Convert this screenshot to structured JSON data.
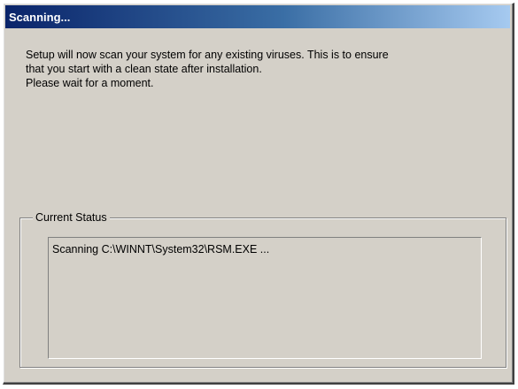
{
  "window": {
    "title": "Scanning..."
  },
  "message": {
    "line1": "Setup will now scan your system for any existing viruses. This is to ensure",
    "line2": "that you start with a clean state after installation.",
    "line3": "Please wait for a moment."
  },
  "status_group": {
    "label": "Current Status",
    "text": "Scanning C:\\WINNT\\System32\\RSM.EXE ..."
  },
  "colors": {
    "title_start": "#0a246a",
    "title_end": "#a6caf0",
    "dialog_face": "#d4d0c8"
  }
}
